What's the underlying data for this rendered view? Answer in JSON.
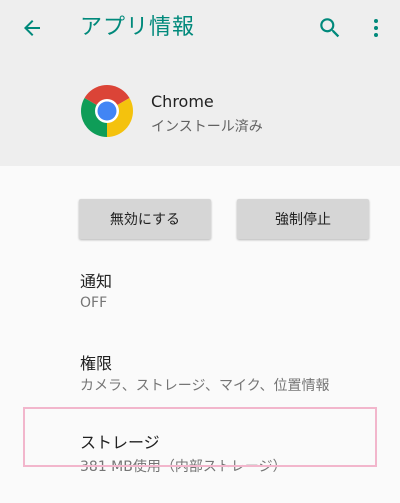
{
  "appbar": {
    "title": "アプリ情報",
    "back_icon": "arrow-back-icon",
    "search_icon": "search-icon",
    "more_icon": "more-vert-icon"
  },
  "app": {
    "name": "Chrome",
    "status": "インストール済み",
    "icon": "chrome-icon"
  },
  "actions": {
    "disable_label": "無効にする",
    "force_stop_label": "強制停止"
  },
  "settings": {
    "notifications": {
      "title": "通知",
      "summary": "OFF"
    },
    "permissions": {
      "title": "権限",
      "summary": "カメラ、ストレージ、マイク、位置情報"
    },
    "storage": {
      "title": "ストレージ",
      "summary": "381 MB使用（内部ストレージ）"
    }
  },
  "colors": {
    "accent": "#00897b",
    "header_bg": "#eeeeee",
    "page_bg": "#fafafa",
    "highlight_border": "#f2b6cc"
  }
}
